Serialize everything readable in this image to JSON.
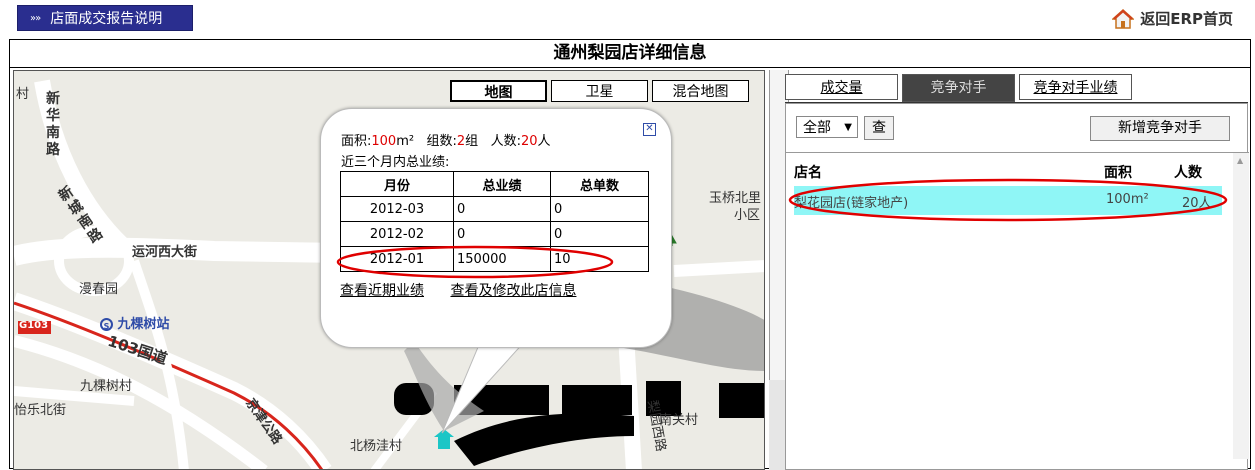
{
  "top_button": {
    "arrows": "»»",
    "label": "店面成交报告说明"
  },
  "home_link": {
    "label": "返回ERP首页"
  },
  "frame": {
    "title": "通州梨园店详细信息"
  },
  "map": {
    "types": [
      "地图",
      "卫星",
      "混合地图"
    ],
    "active_type": "地图",
    "labels": {
      "cun": "村",
      "xinhua": "新华南路",
      "xincheng": "新城南路",
      "yunhe": "运河西大街",
      "manchun": "漫春园",
      "jiukeshu_station": "九棵树站",
      "g103": "G103",
      "road103": "103国道",
      "jiukeshu_east": "九棵树村",
      "yile": "怡乐北街",
      "jingjin": "京津公路",
      "beiyangwa": "北杨洼村",
      "nanguan": "南关村",
      "liyuan": "梨园西路",
      "yuqiao": "玉桥北里",
      "xiaoqu": "小区"
    }
  },
  "bubble": {
    "area_label": "面积:",
    "area_value": "100",
    "area_unit": "m²",
    "groups_label": "组数:",
    "groups_value": "2",
    "groups_unit": "组",
    "people_label": "人数:",
    "people_value": "20",
    "people_unit": "人",
    "recent_title": "近三个月内总业绩:",
    "table": {
      "headers": [
        "月份",
        "总业绩",
        "总单数"
      ],
      "rows": [
        [
          "2012-03",
          "0",
          "0"
        ],
        [
          "2012-02",
          "0",
          "0"
        ],
        [
          "2012-01",
          "150000",
          "10"
        ]
      ]
    },
    "links": [
      "查看近期业绩",
      "查看及修改此店信息"
    ],
    "close_glyph": "✕"
  },
  "tabs": [
    {
      "label": "成交量",
      "active": false
    },
    {
      "label": "竞争对手",
      "active": true
    },
    {
      "label": "竞争对手业绩",
      "active": false
    }
  ],
  "filter": {
    "selected": "全部",
    "query_button": "查",
    "add_button": "新增竞争对手"
  },
  "competitor_list": {
    "headers": {
      "name": "店名",
      "area": "面积",
      "people": "人数"
    },
    "rows": [
      {
        "name": "梨花园店(链家地产)",
        "area": "100m²",
        "people": "20人"
      }
    ]
  },
  "colors": {
    "accent_blue": "#2a2e8f",
    "highlight_row": "#8ff6f6",
    "annotation_red": "#e00000"
  }
}
